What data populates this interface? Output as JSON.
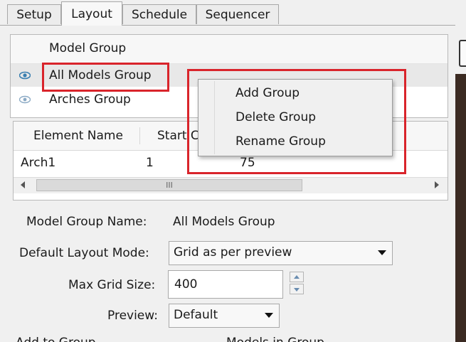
{
  "tabs": [
    "Setup",
    "Layout",
    "Schedule",
    "Sequencer"
  ],
  "groups": {
    "column_header": "Model Group",
    "rows": [
      {
        "name": "All Models Group",
        "selected": true
      },
      {
        "name": "Arches Group",
        "selected": false
      }
    ]
  },
  "elements": {
    "columns": [
      "Element Name",
      "Start C"
    ],
    "rows": [
      {
        "name": "Arch1",
        "start": "1",
        "value": "75"
      }
    ],
    "scroll_thumb_glyph": "III"
  },
  "context_menu": {
    "items": [
      "Add Group",
      "Delete Group",
      "Rename Group"
    ]
  },
  "form": {
    "model_group_name_label": "Model Group Name:",
    "model_group_name_value": "All Models Group",
    "default_layout_mode_label": "Default Layout Mode:",
    "default_layout_mode_value": "Grid as per preview",
    "max_grid_size_label": "Max Grid Size:",
    "max_grid_size_value": "400",
    "preview_label": "Preview:",
    "preview_value": "Default",
    "cut_off_left": "Add to Group",
    "cut_off_right": "Models in Group"
  },
  "colors": {
    "highlight_box": "#d9242b",
    "eye_active": "#3a7fb0",
    "eye_inactive": "#8aa9c4"
  }
}
